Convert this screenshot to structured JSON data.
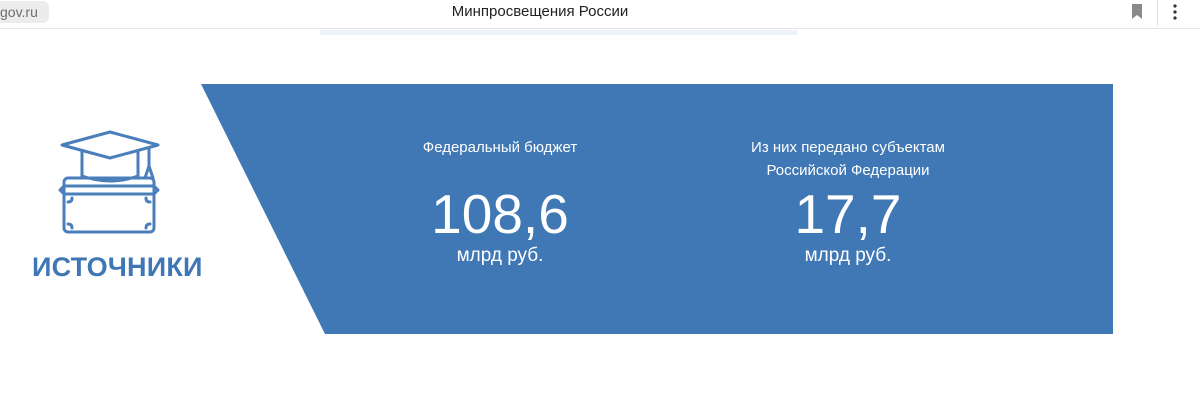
{
  "browser": {
    "url": "gov.ru",
    "page_title": "Минпросвещения России",
    "icons": [
      "bookmark-icon",
      "kebab-menu-icon"
    ]
  },
  "colors": {
    "banner_blue": "#4077b5",
    "label_blue": "#3f76b5",
    "icon_blue": "#4a7fbb"
  },
  "section": {
    "label": "ИСТОЧНИКИ",
    "icon": "graduation-cap-suitcase-icon"
  },
  "stats": [
    {
      "label": "Федеральный бюджет",
      "value": "108,6",
      "unit": "млрд руб."
    },
    {
      "label_line1": "Из них передано субъектам",
      "label_line2": "Российской Федерации",
      "value": "17,7",
      "unit": "млрд руб."
    }
  ]
}
